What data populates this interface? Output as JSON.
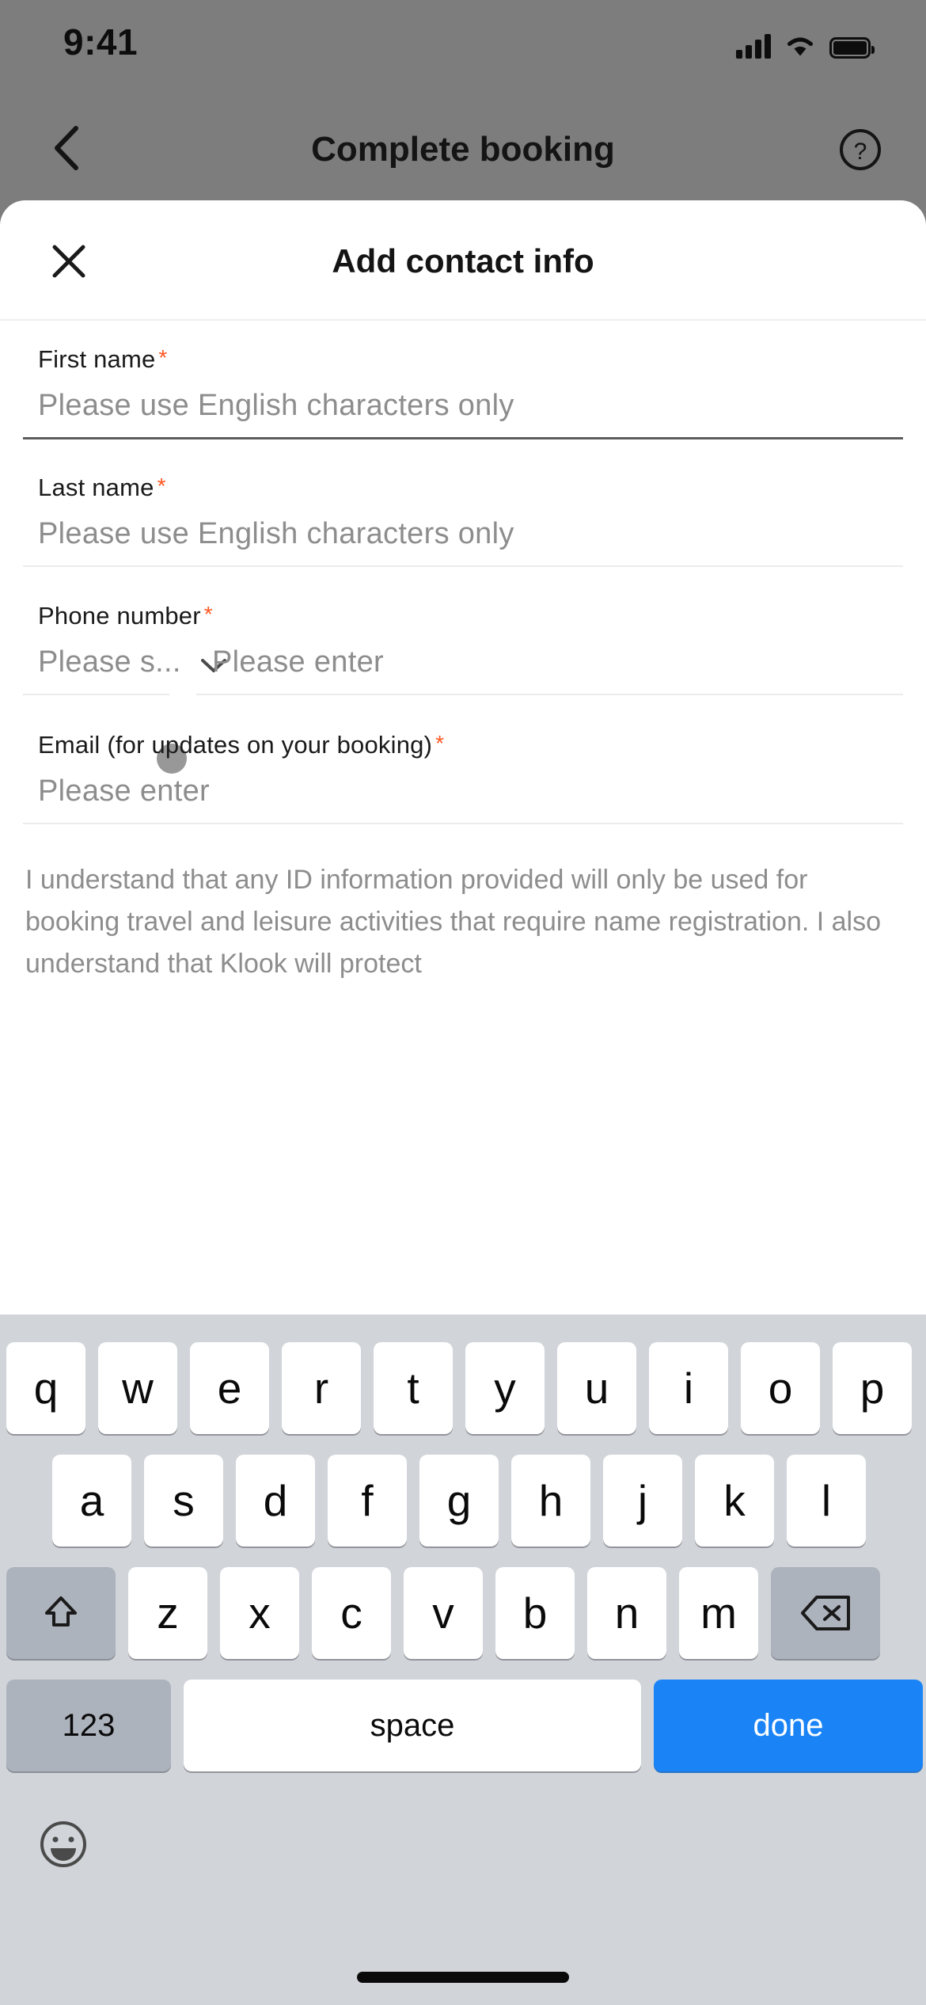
{
  "status_bar": {
    "time": "9:41",
    "cellular_icon": "signal-bars-icon",
    "wifi_icon": "wifi-icon",
    "battery_icon": "battery-full-icon"
  },
  "nav_bar": {
    "back_icon": "chevron-left-icon",
    "title": "Complete booking",
    "help_icon": "question-mark-circle-icon"
  },
  "sheet": {
    "close_icon": "close-x-icon",
    "title": "Add contact info"
  },
  "form": {
    "required_marker": "*",
    "fields": [
      {
        "key": "first_name",
        "label": "First name",
        "required": true,
        "placeholder": "Please use English characters only",
        "value": "",
        "focused": true
      },
      {
        "key": "last_name",
        "label": "Last name",
        "required": true,
        "placeholder": "Please use English characters only",
        "value": "",
        "focused": false
      },
      {
        "key": "phone_number",
        "label": "Phone number",
        "required": true,
        "country_code_placeholder": "Please s...",
        "country_code_value": "",
        "country_code_chevron_icon": "chevron-down-icon",
        "placeholder": "Please enter",
        "value": "",
        "focused": false
      },
      {
        "key": "email",
        "label": "Email (for updates on your booking)",
        "required": true,
        "placeholder": "Please enter",
        "value": "",
        "focused": false
      }
    ],
    "disclaimer": "I understand that any ID information provided will only be used for booking travel and leisure activities that require name registration. I also understand that Klook will protect"
  },
  "touch_indicator": {
    "name": "touch-point",
    "color": "#707070"
  },
  "keyboard": {
    "background_color": "#d1d4d9",
    "row1": [
      "q",
      "w",
      "e",
      "r",
      "t",
      "y",
      "u",
      "i",
      "o",
      "p"
    ],
    "row2": [
      "a",
      "s",
      "d",
      "f",
      "g",
      "h",
      "j",
      "k",
      "l"
    ],
    "row3_letters": [
      "z",
      "x",
      "c",
      "v",
      "b",
      "n",
      "m"
    ],
    "shift_icon": "shift-arrow-up-icon",
    "backspace_icon": "backspace-delete-icon",
    "numbers_key": "123",
    "space_key": "space",
    "done_key": "done",
    "done_key_color": "#1a84f7",
    "emoji_icon": "emoji-smiley-icon"
  },
  "home_indicator": "home-bar"
}
